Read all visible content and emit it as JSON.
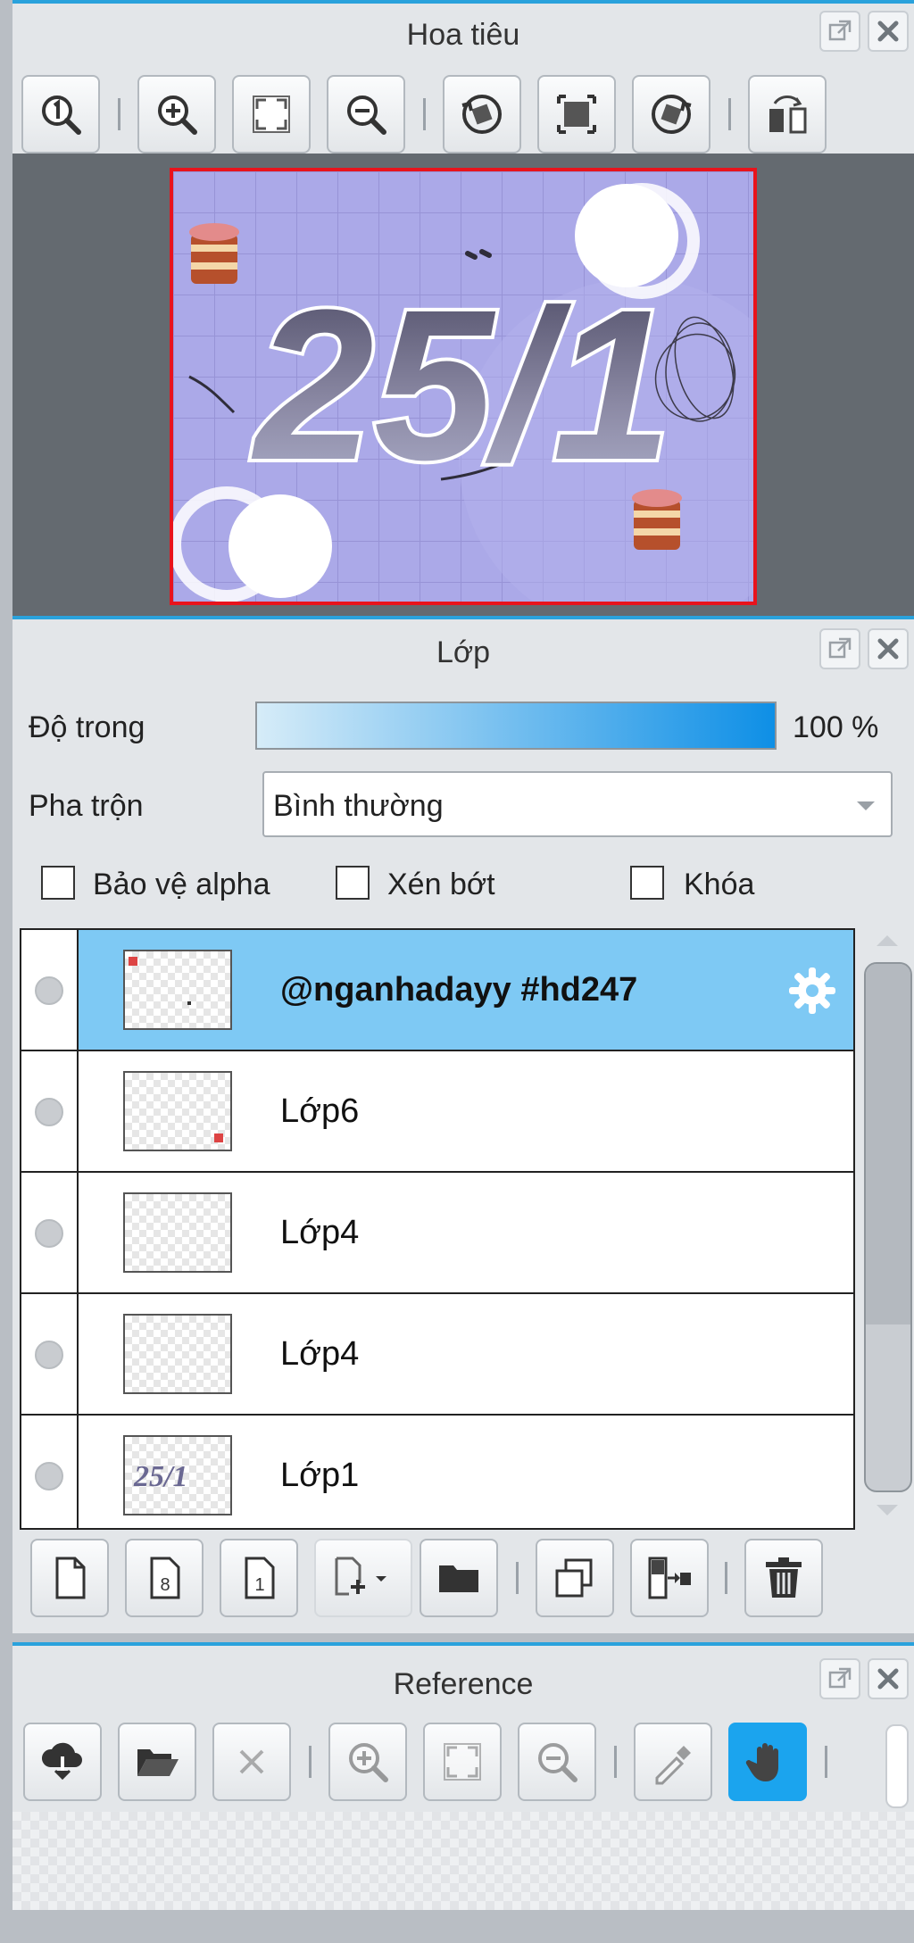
{
  "navigator": {
    "title": "Hoa tiêu",
    "artwork_text": "25/1"
  },
  "layers_panel": {
    "title": "Lớp",
    "opacity_label": "Độ trong",
    "opacity_value": "100 %",
    "blend_label": "Pha trộn",
    "blend_value": "Bình thường",
    "protect_alpha_label": "Bảo vệ alpha",
    "clipping_label": "Xén bớt",
    "lock_label": "Khóa",
    "layers": [
      {
        "name": "@nganhadayy #hd247",
        "selected": true
      },
      {
        "name": "Lớp6",
        "selected": false
      },
      {
        "name": "Lớp4",
        "selected": false
      },
      {
        "name": "Lớp4",
        "selected": false
      },
      {
        "name": "Lớp1",
        "selected": false
      }
    ]
  },
  "reference": {
    "title": "Reference"
  },
  "colors": {
    "accent": "#2aa2dc",
    "selected_row": "#7ec9f4",
    "active_tool": "#1ba4ee",
    "canvas_border": "#e8131c"
  }
}
